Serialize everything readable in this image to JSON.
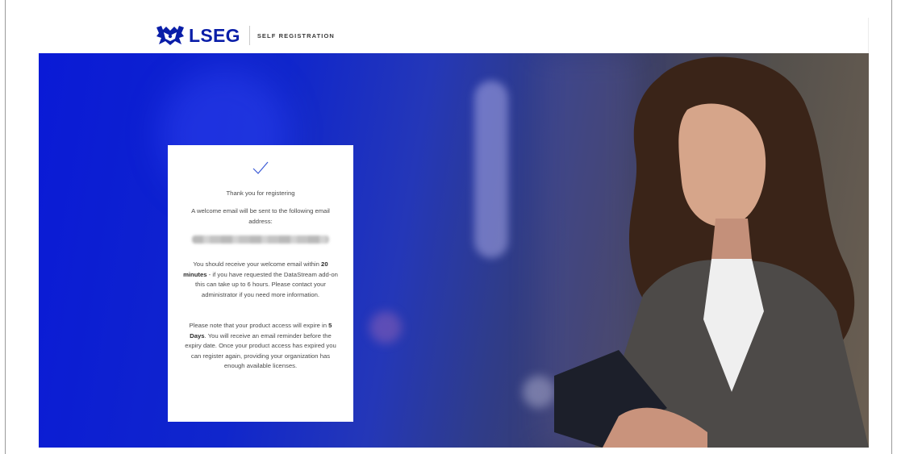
{
  "header": {
    "logo_text": "LSEG",
    "subtitle": "SELF REGISTRATION",
    "brand_color": "#0a1ea8"
  },
  "hero": {
    "gradient_start": "#0a1ad6",
    "gradient_end": "#6b5f52",
    "image_description": "photo background"
  },
  "card": {
    "thanks": "Thank you for registering",
    "welcome": "A welcome email will be sent to the following email address:",
    "email_value": "",
    "receive_pre": "You should receive your welcome email within ",
    "receive_bold": "20 minutes",
    "receive_post": " - if you have requested the DataStream add-on this can take up to 6 hours. Please contact your administrator if you need more information.",
    "note_pre": "Please note that your product access will expire in ",
    "note_bold": "5 Days",
    "note_post": ". You will receive an email reminder before the expiry date. Once your product access has expired you can register again, providing your organization has enough available licenses."
  }
}
